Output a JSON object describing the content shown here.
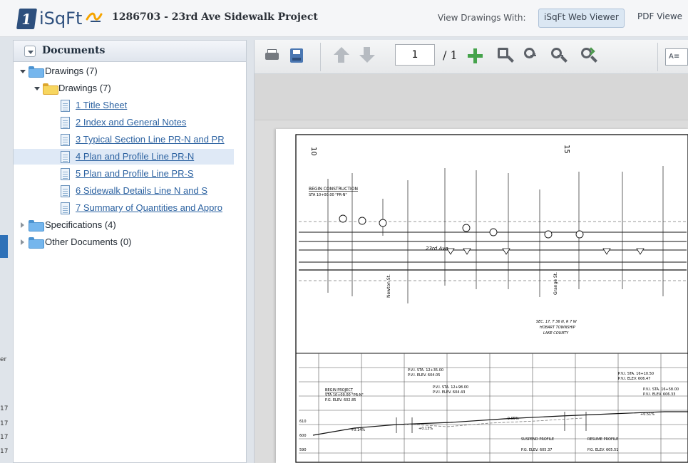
{
  "header": {
    "project_title": "1286703 - 23rd Ave Sidewalk Project",
    "view_with_label": "View Drawings With:",
    "web_viewer_label": "iSqFt Web Viewer",
    "pdf_viewer_label": "PDF Viewe"
  },
  "logo": {
    "mark": "1",
    "text": "iSqFt"
  },
  "sidebar": {
    "title": "Documents",
    "tree": [
      {
        "label": "Drawings (7)",
        "expanded": true
      },
      {
        "label": "Drawings (7)",
        "expanded": true
      },
      {
        "label": "1 Title Sheet"
      },
      {
        "label": "2 Index and General Notes"
      },
      {
        "label": "3 Typical Section Line PR-N and PR"
      },
      {
        "label": "4 Plan and Profile Line PR-N",
        "selected": true
      },
      {
        "label": "5 Plan and Profile Line PR-S"
      },
      {
        "label": "6 Sidewalk Details Line N and S"
      },
      {
        "label": "7 Summary of Quantities and Appro"
      },
      {
        "label": "Specifications (4)",
        "expanded": false
      },
      {
        "label": "Other Documents (0)",
        "expanded": false
      }
    ]
  },
  "viewer": {
    "page_current": "1",
    "page_total": "/ 1",
    "text_tool_label": "A≡",
    "plan": {
      "left_label": "10",
      "right_label": "15",
      "begin_construction": "BEGIN CONSTRUCTION",
      "begin_station": "STA 10+00.00 \"PR-N\"",
      "street_label": "23rd Ave",
      "section_note_1": "SEC. 17, T 36 N, R 7 W",
      "section_note_2": "HOBART TOWNSHIP",
      "section_note_3": "LAKE COUNTY",
      "left_road": "Newton St.",
      "right_road": "Grange St."
    },
    "profile": {
      "y_labels": [
        "610",
        "600",
        "590"
      ],
      "pvi_1": "P.V.I. STA. 12+35.00",
      "pvi_1_elev": "P.V.I. ELEV. 604.05",
      "pvi_2": "P.V.I. STA. 12+98.00",
      "pvi_2_elev": "P.V.I. ELEV. 604.43",
      "pvi_3": "P.V.I. STA. 16+10.50",
      "pvi_3_elev": "P.V.I. ELEV. 606.47",
      "pvi_4": "P.V.I. STA. 16+58.00",
      "pvi_4_elev": "P.V.I. ELEV. 606.33",
      "begin_project": "BEGIN PROJECT",
      "begin_project_sta": "STA 10+00.00 \"PR-N\"",
      "begin_project_elev": "P.G. ELEV. 602.85",
      "suspend_profile": "SUSPEND PROFILE",
      "resume_profile": "RESUME PROFILE",
      "suspend_elev": "P.G. ELEV. 605.37",
      "resume_elev": "P.G. ELEV. 605.51",
      "grade_1": "+0.14%",
      "grade_2": "+0.13%",
      "grade_3": "-0.05%",
      "grade_4": "+0.51%"
    }
  },
  "left_edge": {
    "fragments": [
      "er",
      "17",
      "17",
      "17",
      "17"
    ]
  },
  "colors": {
    "header_bg": "#f5f6f8",
    "panel_border": "#c5ccd5",
    "link": "#2c62a1",
    "selected_row": "#dfe9f6",
    "active_view_button": "#dbe7f3",
    "logo": "#2d4f7d"
  }
}
